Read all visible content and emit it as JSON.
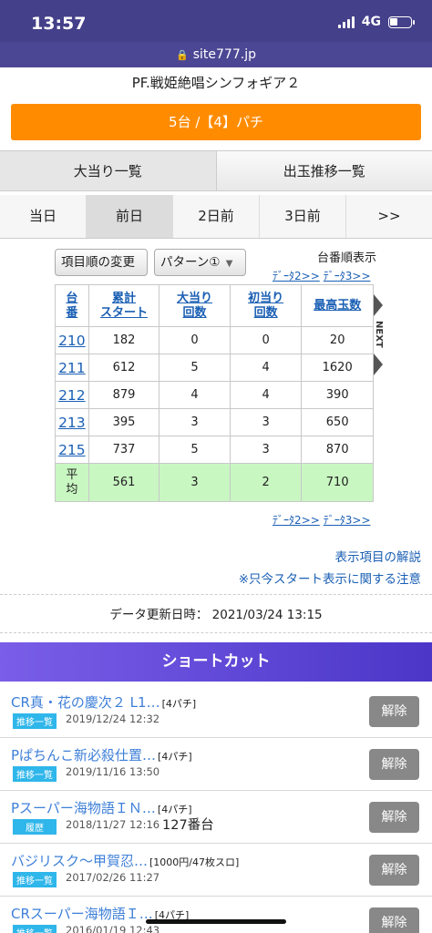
{
  "status": {
    "time": "13:57",
    "network": "4G"
  },
  "url": "site777.jp",
  "machine_title": "PF.戦姫絶唱シンフォギア２",
  "store_button": "5台 /【4】パチ",
  "main_tabs": [
    {
      "label": "大当り一覧"
    },
    {
      "label": "出玉推移一覧"
    }
  ],
  "day_tabs": [
    {
      "label": "当日"
    },
    {
      "label": "前日"
    },
    {
      "label": "2日前"
    },
    {
      "label": "3日前"
    },
    {
      "label": ">>"
    }
  ],
  "controls": {
    "reorder": "項目順の変更",
    "pattern": "パターン①",
    "sort_label": "台番順表示",
    "data2": "ﾃﾞｰﾀ2>>",
    "data3": "ﾃﾞｰﾀ3>>",
    "next": "NEXT"
  },
  "table": {
    "headers": [
      "台\n番",
      "累計\nスタート",
      "大当り\n回数",
      "初当り\n回数",
      "最高玉数"
    ],
    "rows": [
      {
        "no": "210",
        "start": "182",
        "big": "0",
        "first": "0",
        "max": "20"
      },
      {
        "no": "211",
        "start": "612",
        "big": "5",
        "first": "4",
        "max": "1620"
      },
      {
        "no": "212",
        "start": "879",
        "big": "4",
        "first": "4",
        "max": "390"
      },
      {
        "no": "213",
        "start": "395",
        "big": "3",
        "first": "3",
        "max": "650"
      },
      {
        "no": "215",
        "start": "737",
        "big": "5",
        "first": "3",
        "max": "870"
      }
    ],
    "avg": {
      "label": "平\n均",
      "start": "561",
      "big": "3",
      "first": "2",
      "max": "710"
    }
  },
  "links": {
    "explain": "表示項目の解説",
    "notice": "※只今スタート表示に関する注意"
  },
  "updated": "データ更新日時：  2021/03/24 13:15",
  "shortcut": {
    "header": "ショートカット",
    "items": [
      {
        "title": "CR真・花の慶次２ L1…",
        "tag": "[4パチ]",
        "badge": "推移一覧",
        "date": "2019/12/24 12:32",
        "extra": "",
        "delete": "解除"
      },
      {
        "title": "Pぱちんこ新必殺仕置…",
        "tag": "[4パチ]",
        "badge": "推移一覧",
        "date": "2019/11/16 13:50",
        "extra": "",
        "delete": "解除"
      },
      {
        "title": "Pスーパー海物語ＩＮ…",
        "tag": "[4パチ]",
        "badge": "履歴",
        "date": "2018/11/27 12:16",
        "extra": "127番台",
        "delete": "解除"
      },
      {
        "title": "バジリスク～甲賀忍…",
        "tag": "[1000円/47枚スロ]",
        "badge": "推移一覧",
        "date": "2017/02/26 11:27",
        "extra": "",
        "delete": "解除"
      },
      {
        "title": "CRスーパー海物語Ｉ…",
        "tag": "[4パチ]",
        "badge": "推移一覧",
        "date": "2016/01/19 12:43",
        "extra": "",
        "delete": "解除"
      }
    ]
  }
}
